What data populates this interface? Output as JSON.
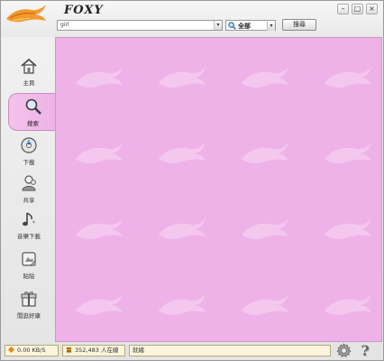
{
  "app": {
    "title": "FOXY"
  },
  "window_controls": {
    "minimize": "–",
    "maximize": "□",
    "close": "×"
  },
  "search": {
    "query": "girl",
    "category": "全部",
    "button_label": "搜尋",
    "dropdown_arrow": "▾"
  },
  "sidebar": {
    "items": [
      {
        "label": "主頁",
        "icon": "home-icon"
      },
      {
        "label": "搜索",
        "icon": "magnifier-icon",
        "active": true
      },
      {
        "label": "下載",
        "icon": "download-disc-icon"
      },
      {
        "label": "共享",
        "icon": "share-icon"
      },
      {
        "label": "音樂下載",
        "icon": "music-note-icon"
      },
      {
        "label": "貼貼",
        "icon": "sticker-icon"
      },
      {
        "label": "閒逛好康",
        "icon": "gift-icon"
      }
    ]
  },
  "status": {
    "speed": "0.00 KB/S",
    "online_users": "352,483 人在線",
    "state": "就緒"
  },
  "colors": {
    "content_bg": "#eeb2e8",
    "accent": "#c98cc0",
    "status_bg": "#fbf5dd"
  }
}
